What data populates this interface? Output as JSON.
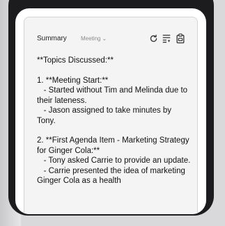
{
  "panel": {
    "title": "Summary",
    "dropdown_label": "Meeting",
    "dropdown_chevron": "⌄"
  },
  "toolbar_icons": [
    "refresh-icon",
    "list-filter-icon",
    "clipboard-icon"
  ],
  "content": {
    "heading": "**Topics Discussed:**",
    "item1_title": "1. **Meeting Start:**",
    "item1_line1": "   - Started without Tim and Melinda due to their lateness.",
    "item1_line2": "   - Jason assigned to take minutes by Tony.",
    "item2_title": "2. **First Agenda Item - Marketing Strategy for Ginger Cola:**",
    "item2_line1": "   - Tony asked Carrie to provide an update.",
    "item2_line2": "   - Carrie presented the idea of marketing Ginger Cola as a health"
  }
}
